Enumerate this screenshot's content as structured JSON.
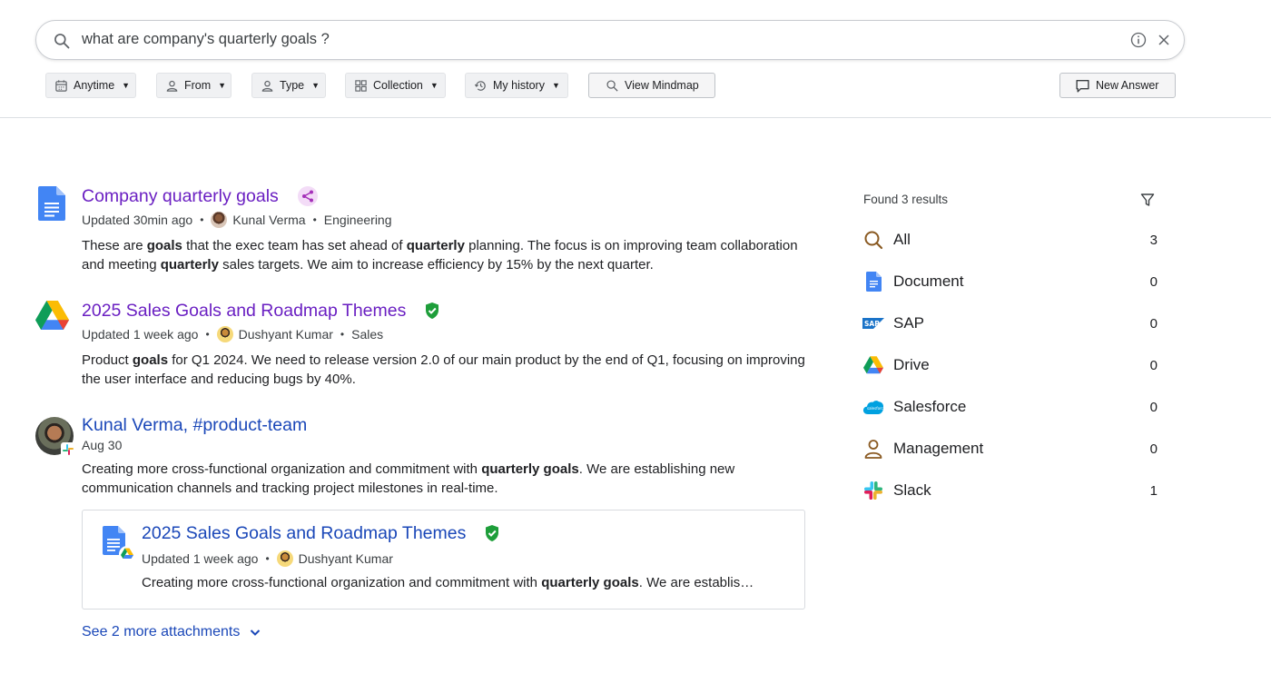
{
  "search": {
    "query": "what are company's quarterly goals ?"
  },
  "filters": [
    {
      "label": "Anytime",
      "icon": "calendar-icon"
    },
    {
      "label": "From",
      "icon": "person-icon"
    },
    {
      "label": "Type",
      "icon": "person-icon"
    },
    {
      "label": "Collection",
      "icon": "grid-icon"
    },
    {
      "label": "My history",
      "icon": "history-icon"
    }
  ],
  "actions": {
    "view_mindmap": "View Mindmap",
    "new_answer": "New Answer"
  },
  "results": [
    {
      "title": "Company quarterly goals",
      "updated": "Updated 30min ago",
      "author": "Kunal Verma",
      "team": "Engineering",
      "snippet": [
        {
          "t": "These are "
        },
        {
          "b": "goals"
        },
        {
          "t": " that the exec team has set ahead of "
        },
        {
          "b": "quarterly"
        },
        {
          "t": " planning. The focus is on improving team collaboration and meeting "
        },
        {
          "b": "quarterly"
        },
        {
          "t": " sales targets. We aim to increase efficiency by 15% by the next quarter."
        }
      ]
    },
    {
      "title": "2025 Sales Goals and Roadmap Themes",
      "updated": "Updated 1 week ago",
      "author": "Dushyant Kumar",
      "team": "Sales",
      "snippet": [
        {
          "t": "Product "
        },
        {
          "b": "goals"
        },
        {
          "t": " for Q1 2024. We need to release version 2.0 of our main product by the end of Q1, focusing on improving the user interface and reducing bugs by 40%."
        }
      ]
    },
    {
      "title": "Kunal Verma, #product-team",
      "date": "Aug 30",
      "snippet": [
        {
          "t": "Creating more cross-functional organization and commitment with "
        },
        {
          "b": "quarterly goals"
        },
        {
          "t": ". We are establishing new communication channels and tracking project milestones in real-time."
        }
      ]
    }
  ],
  "attachment": {
    "title": "2025 Sales Goals and Roadmap Themes",
    "updated": "Updated 1 week ago",
    "author": "Dushyant Kumar",
    "snippet_pre": "Creating more cross-functional organization and commitment with ",
    "snippet_bold": "quarterly goals",
    "snippet_post": ". We are establis…"
  },
  "more_attachments": "See 2 more attachments",
  "sidebar": {
    "found": "Found 3 results",
    "facets": [
      {
        "label": "All",
        "count": "3",
        "icon": "search-icon"
      },
      {
        "label": "Document",
        "count": "0",
        "icon": "document-icon"
      },
      {
        "label": "SAP",
        "count": "0",
        "icon": "sap-icon"
      },
      {
        "label": "Drive",
        "count": "0",
        "icon": "drive-icon"
      },
      {
        "label": "Salesforce",
        "count": "0",
        "icon": "salesforce-icon"
      },
      {
        "label": "Management",
        "count": "0",
        "icon": "person-icon"
      },
      {
        "label": "Slack",
        "count": "1",
        "icon": "slack-icon"
      }
    ]
  },
  "colors": {
    "title_purple": "#6a1fc2",
    "title_blue": "#1a47b8",
    "verified_green": "#1e9e3a"
  }
}
